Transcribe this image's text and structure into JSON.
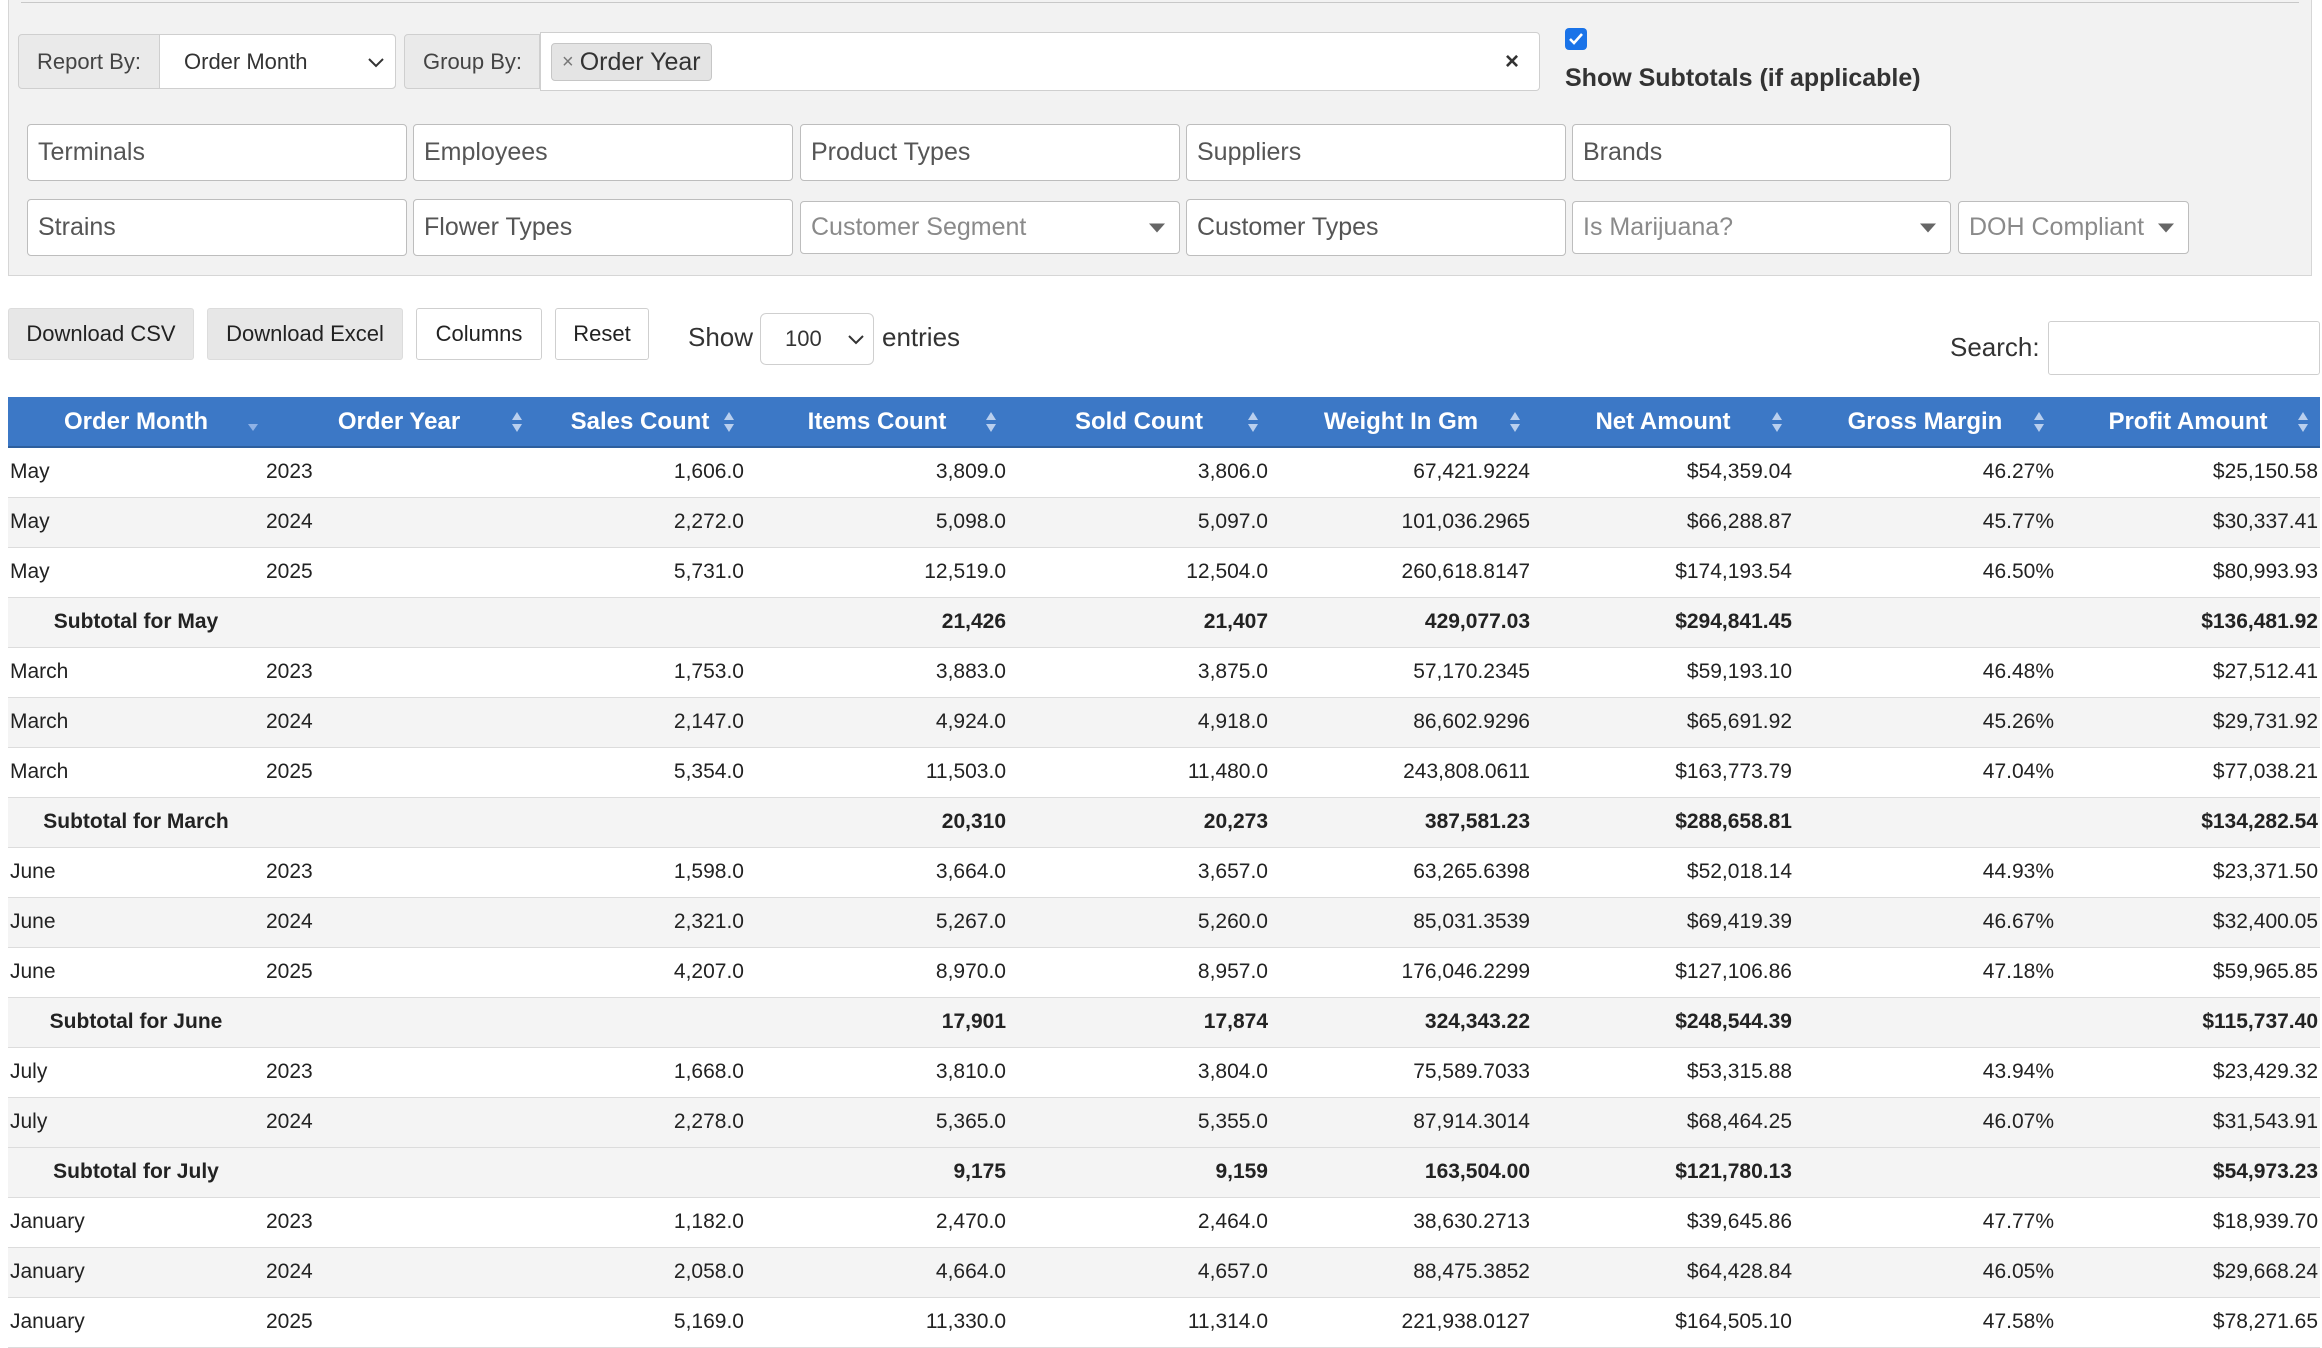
{
  "filters": {
    "report_by_label": "Report By:",
    "report_by_value": "Order Month",
    "group_by_label": "Group By:",
    "group_by_tag": "Order Year",
    "group_by_tag_remove": "×",
    "group_by_clear": "×",
    "show_subtotals_label": "Show Subtotals (if applicable)",
    "row1": [
      "Terminals",
      "Employees",
      "Product Types",
      "Suppliers",
      "Brands"
    ],
    "row2_text": [
      "Strains",
      "Flower Types"
    ],
    "customer_segment": "Customer Segment",
    "customer_types": "Customer Types",
    "is_marijuana": "Is Marijuana?",
    "doh_compliant": "DOH Compliant"
  },
  "toolbar": {
    "download_csv": "Download CSV",
    "download_excel": "Download Excel",
    "columns": "Columns",
    "reset": "Reset",
    "show_label": "Show",
    "entries_value": "100",
    "entries_label": "entries",
    "search_label": "Search:"
  },
  "table": {
    "headers": [
      "Order Month",
      "Order Year",
      "Sales Count",
      "Items Count",
      "Sold Count",
      "Weight In Gm",
      "Net Amount",
      "Gross Margin",
      "Profit Amount"
    ],
    "rows": [
      {
        "month": "May",
        "year": "2023",
        "sales": "1,606.0",
        "items": "3,809.0",
        "sold": "3,806.0",
        "weight": "67,421.9224",
        "net": "$54,359.04",
        "margin": "46.27%",
        "profit": "$25,150.58"
      },
      {
        "month": "May",
        "year": "2024",
        "sales": "2,272.0",
        "items": "5,098.0",
        "sold": "5,097.0",
        "weight": "101,036.2965",
        "net": "$66,288.87",
        "margin": "45.77%",
        "profit": "$30,337.41"
      },
      {
        "month": "May",
        "year": "2025",
        "sales": "5,731.0",
        "items": "12,519.0",
        "sold": "12,504.0",
        "weight": "260,618.8147",
        "net": "$174,193.54",
        "margin": "46.50%",
        "profit": "$80,993.93"
      },
      {
        "subtotal": "Subtotal for May",
        "items": "21,426",
        "sold": "21,407",
        "weight": "429,077.03",
        "net": "$294,841.45",
        "profit": "$136,481.92"
      },
      {
        "month": "March",
        "year": "2023",
        "sales": "1,753.0",
        "items": "3,883.0",
        "sold": "3,875.0",
        "weight": "57,170.2345",
        "net": "$59,193.10",
        "margin": "46.48%",
        "profit": "$27,512.41"
      },
      {
        "month": "March",
        "year": "2024",
        "sales": "2,147.0",
        "items": "4,924.0",
        "sold": "4,918.0",
        "weight": "86,602.9296",
        "net": "$65,691.92",
        "margin": "45.26%",
        "profit": "$29,731.92"
      },
      {
        "month": "March",
        "year": "2025",
        "sales": "5,354.0",
        "items": "11,503.0",
        "sold": "11,480.0",
        "weight": "243,808.0611",
        "net": "$163,773.79",
        "margin": "47.04%",
        "profit": "$77,038.21"
      },
      {
        "subtotal": "Subtotal for March",
        "items": "20,310",
        "sold": "20,273",
        "weight": "387,581.23",
        "net": "$288,658.81",
        "profit": "$134,282.54"
      },
      {
        "month": "June",
        "year": "2023",
        "sales": "1,598.0",
        "items": "3,664.0",
        "sold": "3,657.0",
        "weight": "63,265.6398",
        "net": "$52,018.14",
        "margin": "44.93%",
        "profit": "$23,371.50"
      },
      {
        "month": "June",
        "year": "2024",
        "sales": "2,321.0",
        "items": "5,267.0",
        "sold": "5,260.0",
        "weight": "85,031.3539",
        "net": "$69,419.39",
        "margin": "46.67%",
        "profit": "$32,400.05"
      },
      {
        "month": "June",
        "year": "2025",
        "sales": "4,207.0",
        "items": "8,970.0",
        "sold": "8,957.0",
        "weight": "176,046.2299",
        "net": "$127,106.86",
        "margin": "47.18%",
        "profit": "$59,965.85"
      },
      {
        "subtotal": "Subtotal for June",
        "items": "17,901",
        "sold": "17,874",
        "weight": "324,343.22",
        "net": "$248,544.39",
        "profit": "$115,737.40"
      },
      {
        "month": "July",
        "year": "2023",
        "sales": "1,668.0",
        "items": "3,810.0",
        "sold": "3,804.0",
        "weight": "75,589.7033",
        "net": "$53,315.88",
        "margin": "43.94%",
        "profit": "$23,429.32"
      },
      {
        "month": "July",
        "year": "2024",
        "sales": "2,278.0",
        "items": "5,365.0",
        "sold": "5,355.0",
        "weight": "87,914.3014",
        "net": "$68,464.25",
        "margin": "46.07%",
        "profit": "$31,543.91"
      },
      {
        "subtotal": "Subtotal for July",
        "items": "9,175",
        "sold": "9,159",
        "weight": "163,504.00",
        "net": "$121,780.13",
        "profit": "$54,973.23"
      },
      {
        "month": "January",
        "year": "2023",
        "sales": "1,182.0",
        "items": "2,470.0",
        "sold": "2,464.0",
        "weight": "38,630.2713",
        "net": "$39,645.86",
        "margin": "47.77%",
        "profit": "$18,939.70"
      },
      {
        "month": "January",
        "year": "2024",
        "sales": "2,058.0",
        "items": "4,664.0",
        "sold": "4,657.0",
        "weight": "88,475.3852",
        "net": "$64,428.84",
        "margin": "46.05%",
        "profit": "$29,668.24"
      },
      {
        "month": "January",
        "year": "2025",
        "sales": "5,169.0",
        "items": "11,330.0",
        "sold": "11,314.0",
        "weight": "221,938.0127",
        "net": "$164,505.10",
        "margin": "47.58%",
        "profit": "$78,271.65"
      }
    ]
  },
  "colors": {
    "header_bg": "#3c78c6",
    "checkbox": "#1a73e8"
  },
  "icons": {
    "sort": "sort-updown-icon",
    "sort_active": "sort-desc-icon",
    "dropdown": "chevron-down-icon",
    "checkbox": "checkbox-checked-icon"
  }
}
